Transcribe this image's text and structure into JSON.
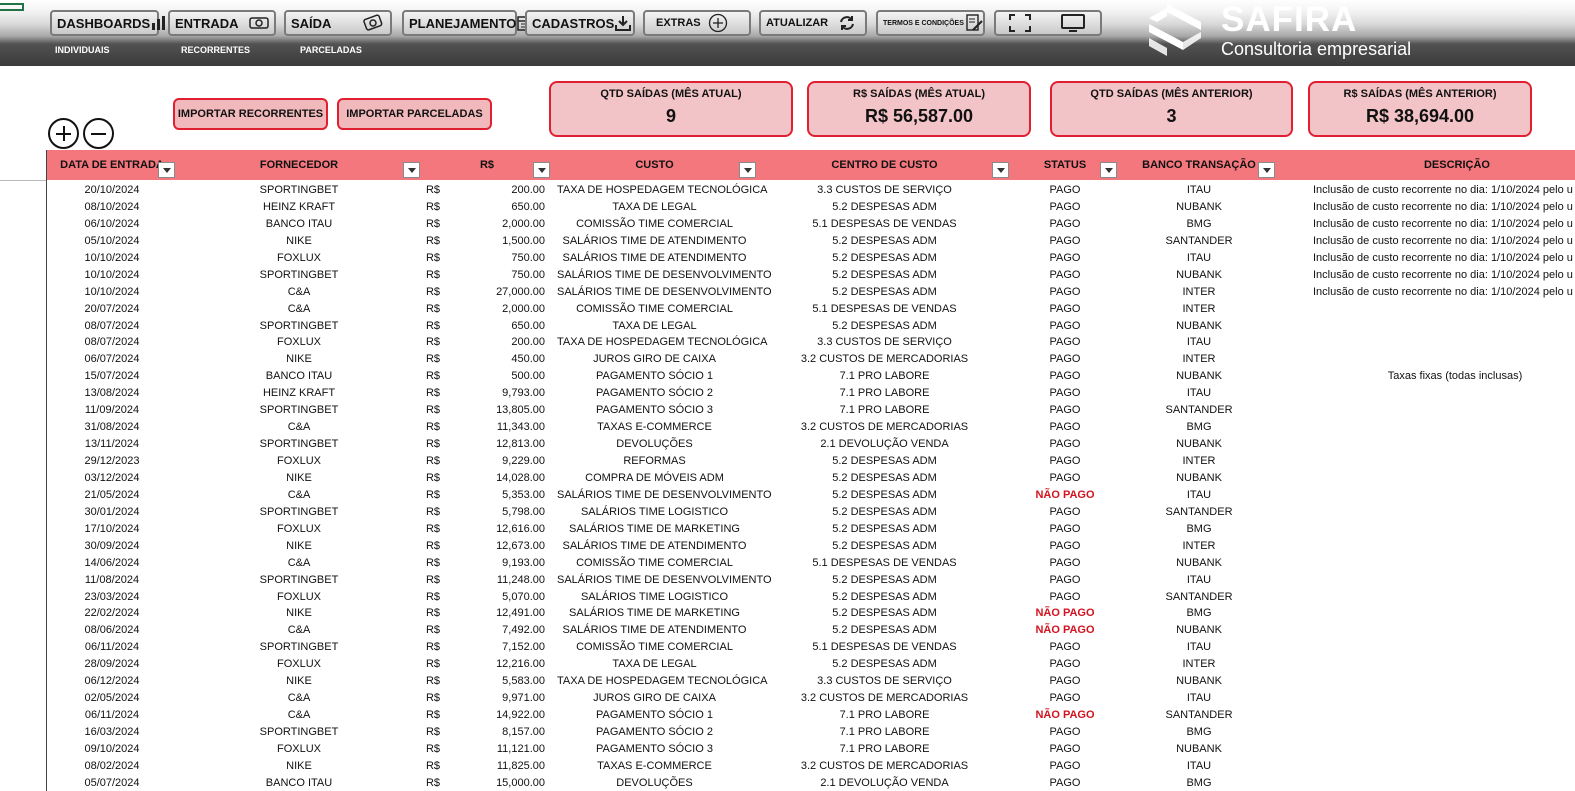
{
  "nav": {
    "buttons": [
      {
        "label": "DASHBOARDS",
        "icon": "dashboard-icon"
      },
      {
        "label": "ENTRADA",
        "icon": "money-in-icon"
      },
      {
        "label": "SAÍDA",
        "icon": "money-out-icon"
      },
      {
        "label": "PLANEJAMENTO",
        "icon": "planning-icon"
      },
      {
        "label": "CADASTROS",
        "icon": "download-icon"
      },
      {
        "label": "EXTRAS",
        "icon": "plus-circle-icon"
      },
      {
        "label": "ATUALIZAR",
        "icon": "refresh-icon"
      },
      {
        "label": "TERMOS E CONDIÇÕES",
        "icon": "document-edit-icon"
      }
    ],
    "view_icons": [
      "fullscreen-icon",
      "monitor-icon"
    ],
    "sub": [
      "INDIVIDUAIS",
      "RECORRENTES",
      "PARCELADAS"
    ]
  },
  "logo": {
    "brand": "SAFIRA",
    "tagline": "Consultoria empresarial"
  },
  "actions": {
    "import_recurring": "IMPORTAR RECORRENTES",
    "import_installments": "IMPORTAR PARCELADAS"
  },
  "kpis": [
    {
      "title": "QTD SAÍDAS (MÊS ATUAL)",
      "value": "9"
    },
    {
      "title": "R$ SAÍDAS (MÊS ATUAL)",
      "value": "R$ 56,587.00"
    },
    {
      "title": "QTD SAÍDAS (MÊS ANTERIOR)",
      "value": "3"
    },
    {
      "title": "R$ SAÍDAS (MÊS ANTERIOR)",
      "value": "R$ 38,694.00"
    }
  ],
  "colors": {
    "header": "#f4777e",
    "kpi_bg": "#f2c4c7",
    "accent": "#e02030",
    "not_paid": "#d4121f"
  },
  "table": {
    "headers": [
      "DATA DE ENTRADA",
      "FORNECEDOR",
      "R$",
      "CUSTO",
      "CENTRO DE CUSTO",
      "STATUS",
      "BANCO TRANSAÇÃO",
      "DESCRIÇÃO"
    ],
    "rows": [
      [
        "20/10/2024",
        "SPORTINGBET",
        "R$",
        "200.00",
        "TAXA DE HOSPEDAGEM TECNOLÓGICA",
        "3.3 CUSTOS DE SERVIÇO",
        "PAGO",
        "ITAU",
        "Inclusão de custo recorrente no dia: 1/10/2024 pelo u"
      ],
      [
        "08/10/2024",
        "HEINZ KRAFT",
        "R$",
        "650.00",
        "TAXA DE LEGAL",
        "5.2 DESPESAS ADM",
        "PAGO",
        "NUBANK",
        "Inclusão de custo recorrente no dia: 1/10/2024 pelo u"
      ],
      [
        "06/10/2024",
        "BANCO ITAU",
        "R$",
        "2,000.00",
        "COMISSÃO TIME COMERCIAL",
        "5.1 DESPESAS DE VENDAS",
        "PAGO",
        "BMG",
        "Inclusão de custo recorrente no dia: 1/10/2024 pelo u"
      ],
      [
        "05/10/2024",
        "NIKE",
        "R$",
        "1,500.00",
        "SALÁRIOS TIME DE ATENDIMENTO",
        "5.2 DESPESAS ADM",
        "PAGO",
        "SANTANDER",
        "Inclusão de custo recorrente no dia: 1/10/2024 pelo u"
      ],
      [
        "10/10/2024",
        "FOXLUX",
        "R$",
        "750.00",
        "SALÁRIOS TIME DE ATENDIMENTO",
        "5.2 DESPESAS ADM",
        "PAGO",
        "ITAU",
        "Inclusão de custo recorrente no dia: 1/10/2024 pelo u"
      ],
      [
        "10/10/2024",
        "SPORTINGBET",
        "R$",
        "750.00",
        "SALÁRIOS TIME DE DESENVOLVIMENTO",
        "5.2 DESPESAS ADM",
        "PAGO",
        "NUBANK",
        "Inclusão de custo recorrente no dia: 1/10/2024 pelo u"
      ],
      [
        "10/10/2024",
        "C&A",
        "R$",
        "27,000.00",
        "SALÁRIOS TIME DE DESENVOLVIMENTO",
        "5.2 DESPESAS ADM",
        "PAGO",
        "INTER",
        "Inclusão de custo recorrente no dia: 1/10/2024 pelo u"
      ],
      [
        "20/07/2024",
        "C&A",
        "R$",
        "2,000.00",
        "COMISSÃO TIME COMERCIAL",
        "5.1 DESPESAS DE VENDAS",
        "PAGO",
        "INTER",
        ""
      ],
      [
        "08/07/2024",
        "SPORTINGBET",
        "R$",
        "650.00",
        "TAXA DE LEGAL",
        "5.2 DESPESAS ADM",
        "PAGO",
        "NUBANK",
        ""
      ],
      [
        "08/07/2024",
        "FOXLUX",
        "R$",
        "200.00",
        "TAXA DE HOSPEDAGEM TECNOLÓGICA",
        "3.3 CUSTOS DE SERVIÇO",
        "PAGO",
        "ITAU",
        ""
      ],
      [
        "06/07/2024",
        "NIKE",
        "R$",
        "450.00",
        "JUROS GIRO DE CAIXA",
        "3.2 CUSTOS DE MERCADORIAS",
        "PAGO",
        "INTER",
        ""
      ],
      [
        "15/07/2024",
        "BANCO ITAU",
        "R$",
        "500.00",
        "PAGAMENTO SÓCIO 1",
        "7.1 PRO LABORE",
        "PAGO",
        "NUBANK",
        "Taxas fixas (todas inclusas)"
      ],
      [
        "13/08/2024",
        "HEINZ KRAFT",
        "R$",
        "9,793.00",
        "PAGAMENTO SÓCIO 2",
        "7.1 PRO LABORE",
        "PAGO",
        "ITAU",
        ""
      ],
      [
        "11/09/2024",
        "SPORTINGBET",
        "R$",
        "13,805.00",
        "PAGAMENTO SÓCIO 3",
        "7.1 PRO LABORE",
        "PAGO",
        "SANTANDER",
        ""
      ],
      [
        "31/08/2024",
        "C&A",
        "R$",
        "11,343.00",
        "TAXAS E-COMMERCE",
        "3.2 CUSTOS DE MERCADORIAS",
        "PAGO",
        "BMG",
        ""
      ],
      [
        "13/11/2024",
        "SPORTINGBET",
        "R$",
        "12,813.00",
        "DEVOLUÇÕES",
        "2.1 DEVOLUÇÃO VENDA",
        "PAGO",
        "NUBANK",
        ""
      ],
      [
        "29/12/2023",
        "FOXLUX",
        "R$",
        "9,229.00",
        "REFORMAS",
        "5.2 DESPESAS ADM",
        "PAGO",
        "INTER",
        ""
      ],
      [
        "03/12/2024",
        "NIKE",
        "R$",
        "14,028.00",
        "COMPRA DE MÓVEIS ADM",
        "5.2 DESPESAS ADM",
        "PAGO",
        "NUBANK",
        ""
      ],
      [
        "21/05/2024",
        "C&A",
        "R$",
        "5,353.00",
        "SALÁRIOS TIME DE DESENVOLVIMENTO",
        "5.2 DESPESAS ADM",
        "NÃO PAGO",
        "ITAU",
        ""
      ],
      [
        "30/01/2024",
        "SPORTINGBET",
        "R$",
        "5,798.00",
        "SALÁRIOS TIME LOGISTICO",
        "5.2 DESPESAS ADM",
        "PAGO",
        "SANTANDER",
        ""
      ],
      [
        "17/10/2024",
        "FOXLUX",
        "R$",
        "12,616.00",
        "SALÁRIOS TIME DE MARKETING",
        "5.2 DESPESAS ADM",
        "PAGO",
        "BMG",
        ""
      ],
      [
        "30/09/2024",
        "NIKE",
        "R$",
        "12,673.00",
        "SALÁRIOS TIME DE ATENDIMENTO",
        "5.2 DESPESAS ADM",
        "PAGO",
        "INTER",
        ""
      ],
      [
        "14/06/2024",
        "C&A",
        "R$",
        "9,193.00",
        "COMISSÃO TIME COMERCIAL",
        "5.1 DESPESAS DE VENDAS",
        "PAGO",
        "NUBANK",
        ""
      ],
      [
        "11/08/2024",
        "SPORTINGBET",
        "R$",
        "11,248.00",
        "SALÁRIOS TIME DE DESENVOLVIMENTO",
        "5.2 DESPESAS ADM",
        "PAGO",
        "ITAU",
        ""
      ],
      [
        "23/03/2024",
        "FOXLUX",
        "R$",
        "5,070.00",
        "SALÁRIOS TIME LOGISTICO",
        "5.2 DESPESAS ADM",
        "PAGO",
        "SANTANDER",
        ""
      ],
      [
        "22/02/2024",
        "NIKE",
        "R$",
        "12,491.00",
        "SALÁRIOS TIME DE MARKETING",
        "5.2 DESPESAS ADM",
        "NÃO PAGO",
        "BMG",
        ""
      ],
      [
        "08/06/2024",
        "C&A",
        "R$",
        "7,492.00",
        "SALÁRIOS TIME DE ATENDIMENTO",
        "5.2 DESPESAS ADM",
        "NÃO PAGO",
        "NUBANK",
        ""
      ],
      [
        "06/11/2024",
        "SPORTINGBET",
        "R$",
        "7,152.00",
        "COMISSÃO TIME COMERCIAL",
        "5.1 DESPESAS DE VENDAS",
        "PAGO",
        "ITAU",
        ""
      ],
      [
        "28/09/2024",
        "FOXLUX",
        "R$",
        "12,216.00",
        "TAXA DE LEGAL",
        "5.2 DESPESAS ADM",
        "PAGO",
        "INTER",
        ""
      ],
      [
        "06/12/2024",
        "NIKE",
        "R$",
        "5,583.00",
        "TAXA DE HOSPEDAGEM TECNOLÓGICA",
        "3.3 CUSTOS DE SERVIÇO",
        "PAGO",
        "NUBANK",
        ""
      ],
      [
        "02/05/2024",
        "C&A",
        "R$",
        "9,971.00",
        "JUROS GIRO DE CAIXA",
        "3.2 CUSTOS DE MERCADORIAS",
        "PAGO",
        "ITAU",
        ""
      ],
      [
        "06/11/2024",
        "C&A",
        "R$",
        "14,922.00",
        "PAGAMENTO SÓCIO 1",
        "7.1 PRO LABORE",
        "NÃO PAGO",
        "SANTANDER",
        ""
      ],
      [
        "16/03/2024",
        "SPORTINGBET",
        "R$",
        "8,157.00",
        "PAGAMENTO SÓCIO 2",
        "7.1 PRO LABORE",
        "PAGO",
        "BMG",
        ""
      ],
      [
        "09/10/2024",
        "FOXLUX",
        "R$",
        "11,121.00",
        "PAGAMENTO SÓCIO 3",
        "7.1 PRO LABORE",
        "PAGO",
        "NUBANK",
        ""
      ],
      [
        "08/02/2024",
        "NIKE",
        "R$",
        "11,825.00",
        "TAXAS E-COMMERCE",
        "3.2 CUSTOS DE MERCADORIAS",
        "PAGO",
        "ITAU",
        ""
      ],
      [
        "05/07/2024",
        "BANCO ITAU",
        "R$",
        "15,000.00",
        "DEVOLUÇÕES",
        "2.1 DEVOLUÇÃO VENDA",
        "PAGO",
        "BMG",
        ""
      ]
    ]
  }
}
